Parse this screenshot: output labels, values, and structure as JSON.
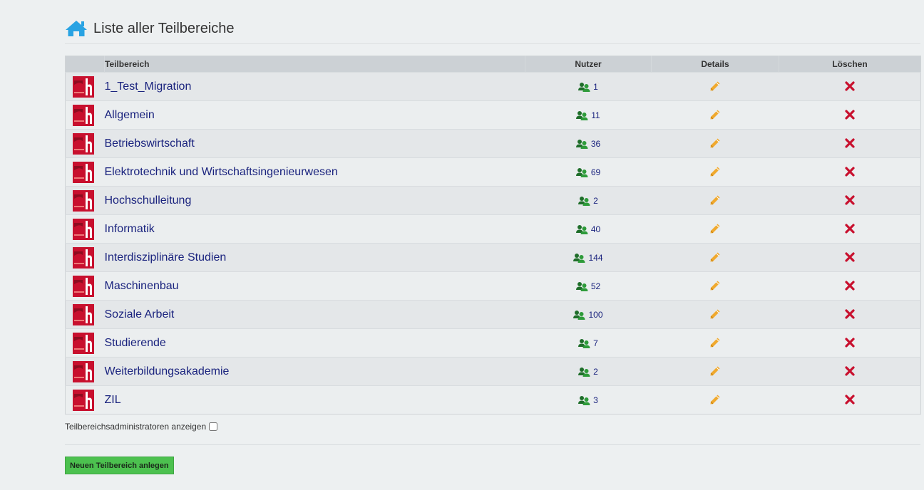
{
  "header": {
    "title": "Liste aller Teilbereiche",
    "icon": "home-icon",
    "icon_color": "#29a3e3"
  },
  "table": {
    "columns": {
      "name": "Teilbereich",
      "users": "Nutzer",
      "details": "Details",
      "delete": "Löschen"
    },
    "rows": [
      {
        "name": "1_Test_Migration",
        "users": "1"
      },
      {
        "name": "Allgemein",
        "users": "11"
      },
      {
        "name": "Betriebswirtschaft",
        "users": "36"
      },
      {
        "name": "Elektrotechnik und Wirtschaftsingenieurwesen",
        "users": "69"
      },
      {
        "name": "Hochschulleitung",
        "users": "2"
      },
      {
        "name": "Informatik",
        "users": "40"
      },
      {
        "name": "Interdisziplinäre Studien",
        "users": "144"
      },
      {
        "name": "Maschinenbau",
        "users": "52"
      },
      {
        "name": "Soziale Arbeit",
        "users": "100"
      },
      {
        "name": "Studierende",
        "users": "7"
      },
      {
        "name": "Weiterbildungsakademie",
        "users": "2"
      },
      {
        "name": "ZIL",
        "users": "3"
      }
    ]
  },
  "admins_toggle": {
    "label": "Teilbereichsadministratoren anzeigen",
    "checked": false
  },
  "add_button": {
    "label": "Neuen Teilbereich anlegen"
  },
  "colors": {
    "edit": "#f0a92e",
    "delete": "#c8102e",
    "users": "#2e9b3a",
    "button": "#4cc14f",
    "logo": "#c8102e"
  }
}
